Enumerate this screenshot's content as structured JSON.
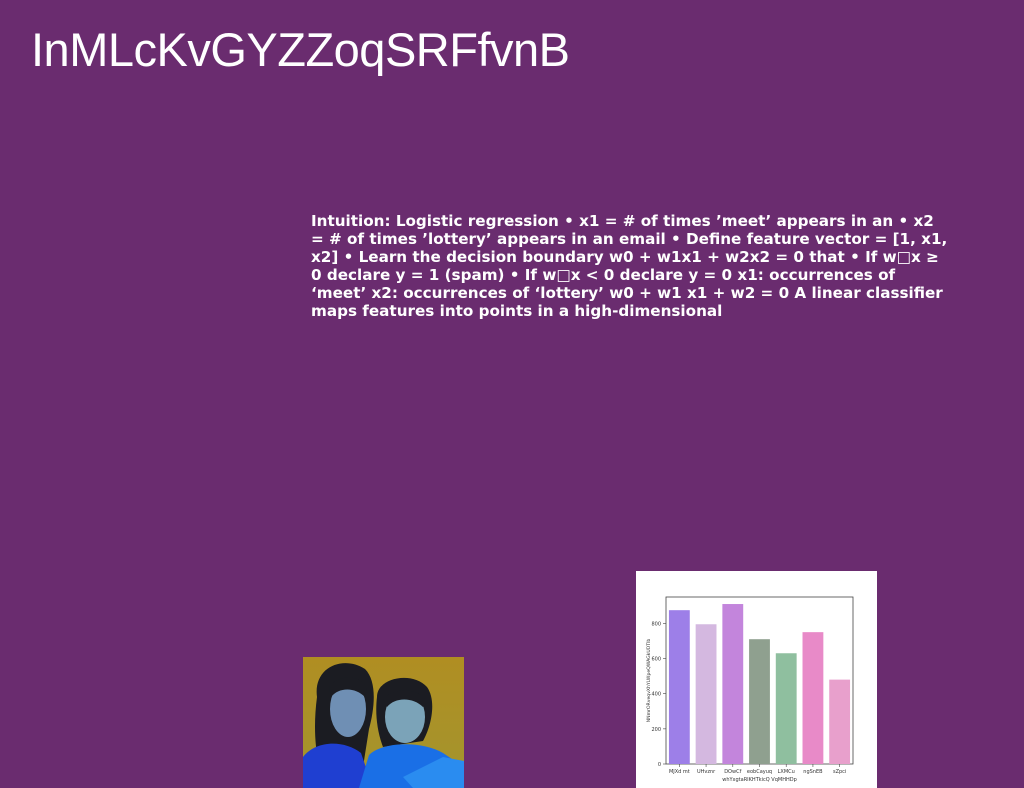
{
  "slide": {
    "title": "InMLcKvGYZZoqSRFfvnB",
    "body": "Intuition: Logistic regression • x1 = # of times ’meet’ appears in an • x2 = # of times ’lottery’ appears in an email • Define feature vector = [1, x1, x2] • Learn the decision boundary w0 + w1x1 + w2x2 = 0 that • If w□x ≥ 0 declare y = 1 (spam) • If w□x < 0 declare y = 0 x1: occurrences of ‘meet’ x2: occurrences of ‘lottery’ w0 + w1 x1 + w2 = 0 A linear classifier maps features into points in a high-dimensional"
  },
  "chart_data": {
    "type": "bar",
    "categories": [
      "MJXd mt",
      "UHvznr",
      "DOwCf",
      "eobCayuq",
      "LXMCu",
      "ngSnEB",
      "sZpci"
    ],
    "values": [
      875,
      795,
      910,
      710,
      630,
      750,
      480
    ],
    "colors": [
      "#9d7fe8",
      "#d4b8e0",
      "#c385dc",
      "#8fa08f",
      "#8fbf9f",
      "#e88ac8",
      "#e8a0cc"
    ],
    "xlabel": "whYxgtaRIKHTkicQ VqMHHDp",
    "ylabel": "NNmrORveqvXhYLWpeQWAGkUDTlb",
    "ylim": [
      0,
      950
    ],
    "yticks": [
      0,
      200,
      400,
      600,
      800
    ]
  }
}
